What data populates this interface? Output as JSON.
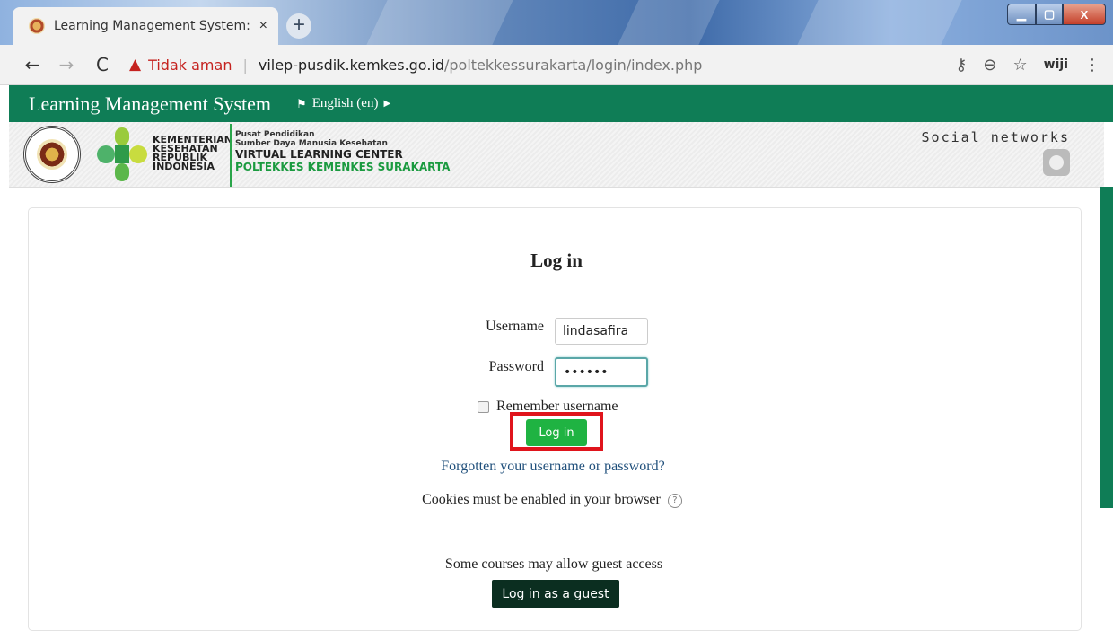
{
  "browser": {
    "tab_title": "Learning Management System: L",
    "tab_close": "×",
    "new_tab": "+",
    "security_label": "Tidak aman",
    "url_host": "vilep-pusdik.kemkes.go.id",
    "url_path": "/poltekkessurakarta/login/index.php",
    "profile_label": "wiji",
    "window_buttons": {
      "minimize": "▁",
      "maximize": "▢",
      "close": "X"
    }
  },
  "navbar": {
    "brand": "Learning Management System",
    "language": "English (en)"
  },
  "banner": {
    "kemenkes_lines": [
      "KEMENTERIAN",
      "KESEHATAN",
      "REPUBLIK",
      "INDONESIA"
    ],
    "pusat_line1": "Pusat Pendidikan",
    "pusat_line2": "Sumber Daya Manusia Kesehatan",
    "pusat_line3": "VIRTUAL LEARNING CENTER",
    "pusat_line4": "POLTEKKES KEMENKES SURAKARTA",
    "social_label": "Social networks"
  },
  "login": {
    "title": "Log in",
    "username_label": "Username",
    "username_value": "lindasafira",
    "password_label": "Password",
    "password_value": "••••••",
    "remember_label": "Remember username",
    "submit_label": "Log in",
    "forgot_link": "Forgotten your username or password?",
    "cookies_note": "Cookies must be enabled in your browser",
    "help_symbol": "?",
    "guest_note": "Some courses may allow guest access",
    "guest_button": "Log in as a guest"
  },
  "colors": {
    "brand_green": "#0f7d56",
    "login_button": "#1fb342",
    "guest_button": "#0b2e20",
    "highlight_red": "#e0141c"
  }
}
